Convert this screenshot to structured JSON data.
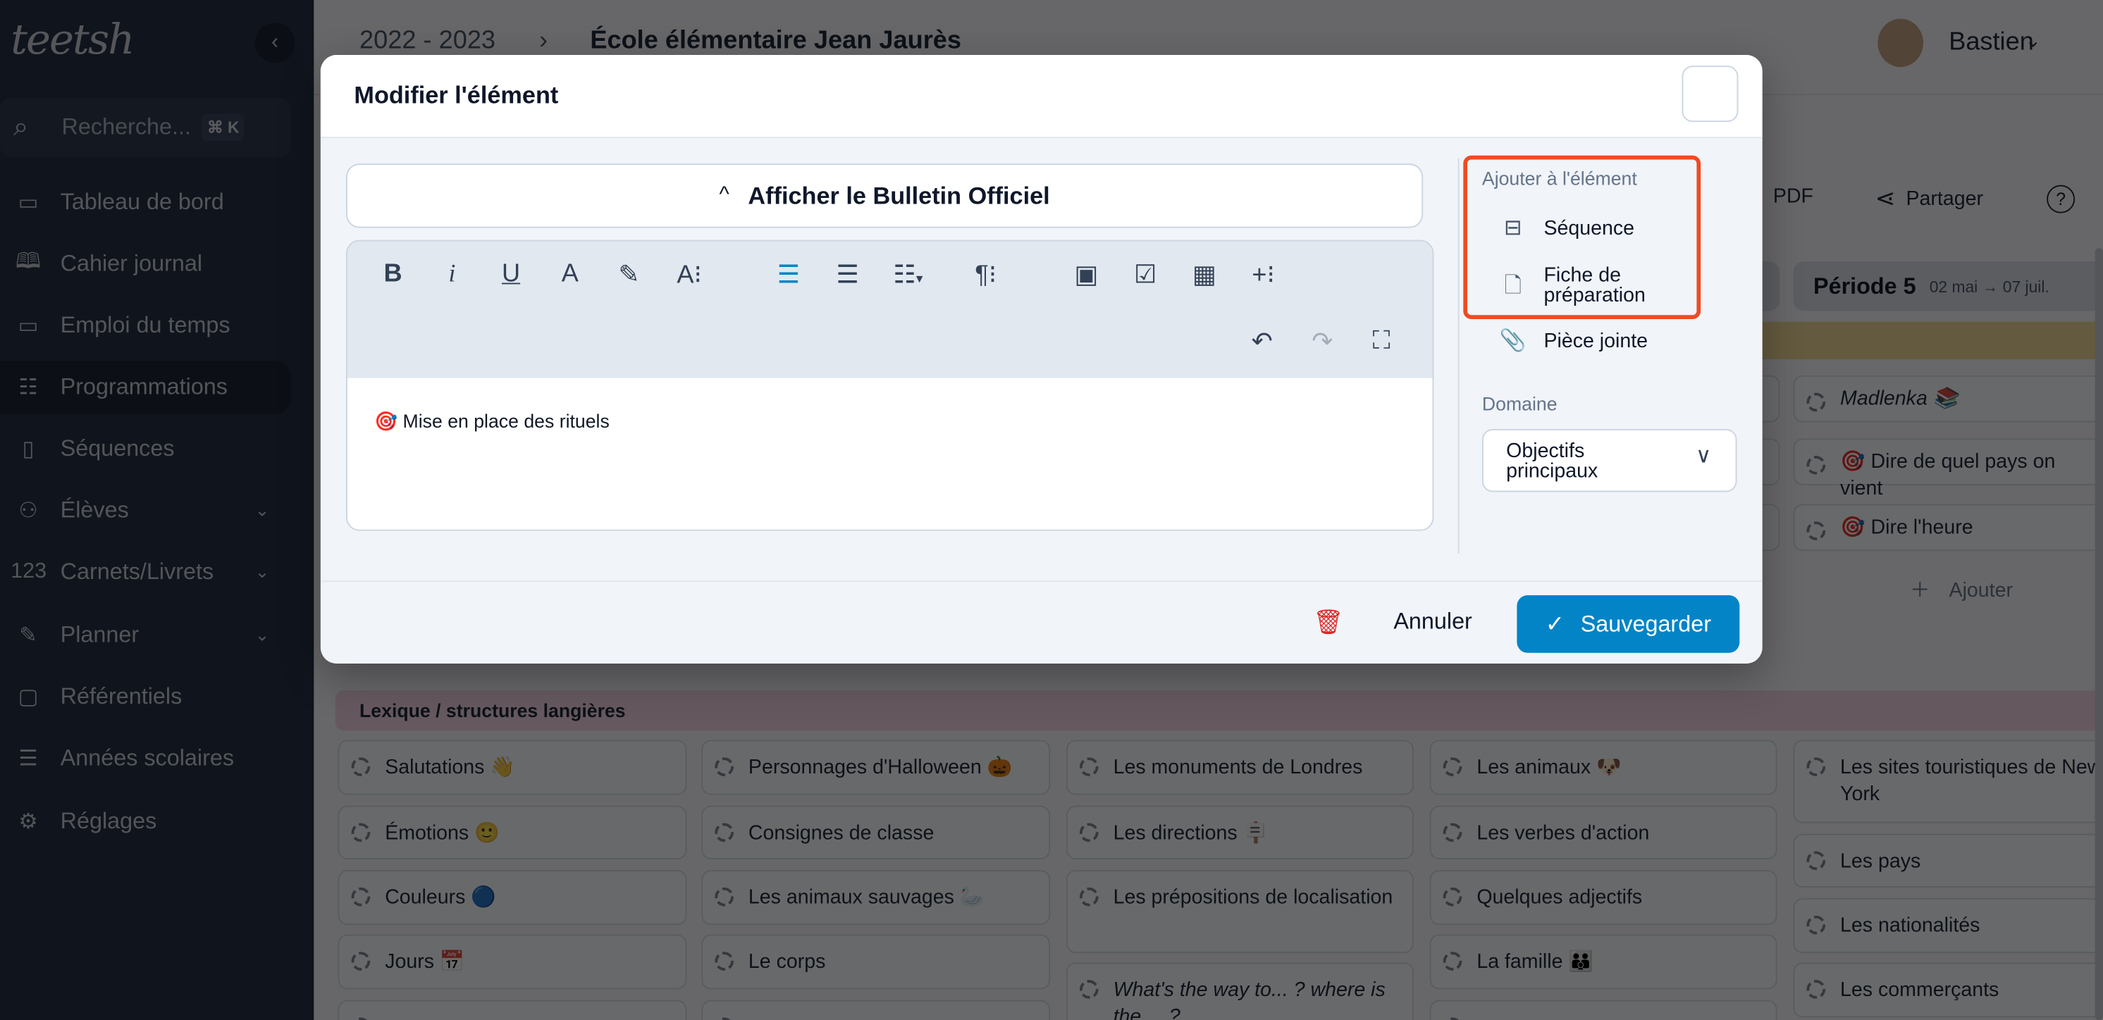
{
  "sidebar": {
    "logo": "teetsh",
    "search_placeholder": "Recherche...",
    "search_shortcut": "⌘ K",
    "items": [
      {
        "label": "Tableau de bord",
        "icon": "dashboard-icon",
        "glyph": "▭"
      },
      {
        "label": "Cahier journal",
        "icon": "book-icon",
        "glyph": "🕮"
      },
      {
        "label": "Emploi du temps",
        "icon": "calendar-icon",
        "glyph": "▭"
      },
      {
        "label": "Programmations",
        "icon": "table-icon",
        "glyph": "☷",
        "active": true
      },
      {
        "label": "Séquences",
        "icon": "document-icon",
        "glyph": "▯"
      },
      {
        "label": "Élèves",
        "icon": "users-icon",
        "glyph": "⚇",
        "chevron": true
      },
      {
        "label": "Carnets/Livrets",
        "icon": "numbers-icon",
        "glyph": "123",
        "chevron": true
      },
      {
        "label": "Planner",
        "icon": "pencil-icon",
        "glyph": "✎",
        "chevron": true
      },
      {
        "label": "Référentiels",
        "icon": "clipboard-icon",
        "glyph": "▢"
      },
      {
        "label": "Années scolaires",
        "icon": "list-icon",
        "glyph": "☰"
      },
      {
        "label": "Réglages",
        "icon": "gear-icon",
        "glyph": "⚙"
      }
    ]
  },
  "header": {
    "breadcrumb_year": "2022 - 2023",
    "breadcrumb_separator": "›",
    "breadcrumb_school": "École élémentaire Jean Jaurès",
    "user_name": "Bastien"
  },
  "toolbar": {
    "pdf_label": "PDF",
    "share_label": "Partager"
  },
  "period": {
    "name": "Période 5",
    "dates": "02 mai → 07 juil."
  },
  "period5_items": [
    {
      "text": "Madlenka 📚",
      "italic": true
    },
    {
      "text": "🎯 Dire de quel pays on vient"
    },
    {
      "text": "🎯 Dire l'heure"
    }
  ],
  "add_label": "Ajouter",
  "lexique_band": "Lexique / structures langières",
  "lexique_columns": [
    [
      "Salutations 👋",
      "Émotions 🙂",
      "Couleurs 🔵",
      "Jours 📅"
    ],
    [
      "Personnages d'Halloween 🎃",
      "Consignes de classe",
      "Les animaux sauvages 🦢",
      "Le corps"
    ],
    [
      "Les monuments de Londres",
      "Les directions 🪧",
      "Les prépositions de localisation",
      "What's the way to... ? where is the ... ?"
    ],
    [
      "Les animaux 🐶",
      "Les verbes d'action",
      "Quelques adjectifs",
      "La famille 👪"
    ],
    [
      "Les sites touristiques de New York",
      "Les pays",
      "Les nationalités",
      "Les commerçants"
    ]
  ],
  "modal": {
    "title": "Modifier l'élément",
    "bulletin_button": "Afficher le Bulletin Officiel",
    "editor_content": "🎯 Mise en place des rituels",
    "add_section_label": "Ajouter à l'élément",
    "add_items": [
      {
        "label": "Séquence",
        "icon": "stack-icon"
      },
      {
        "label": "Fiche de préparation",
        "icon": "document-icon"
      },
      {
        "label": "Pièce jointe",
        "icon": "paperclip-icon"
      }
    ],
    "domain_label": "Domaine",
    "domain_value": "Objectifs principaux",
    "cancel_label": "Annuler",
    "save_label": "Sauvegarder"
  },
  "colors": {
    "accent": "#0284c7",
    "highlight_box": "#f04a23",
    "delete": "#dc2626",
    "active_align": "#0284c7"
  }
}
